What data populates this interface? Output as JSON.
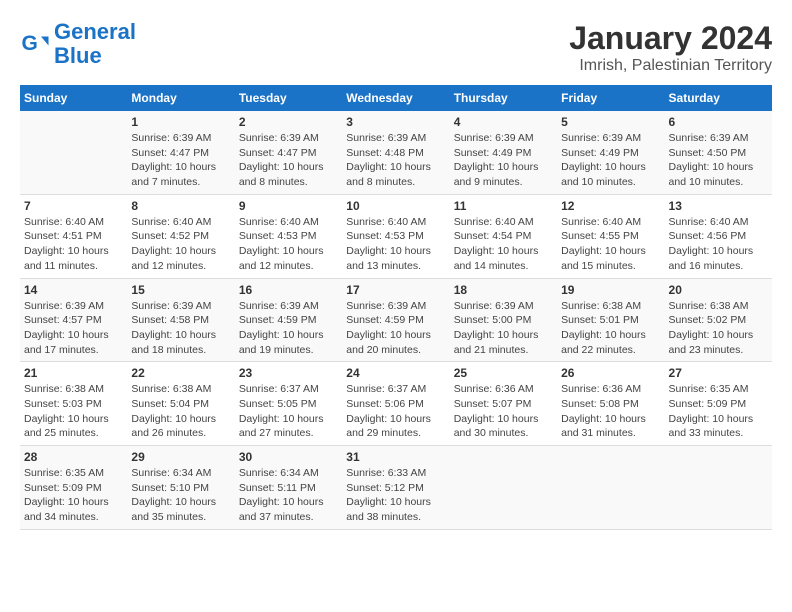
{
  "logo": {
    "line1": "General",
    "line2": "Blue"
  },
  "title": "January 2024",
  "subtitle": "Imrish, Palestinian Territory",
  "weekdays": [
    "Sunday",
    "Monday",
    "Tuesday",
    "Wednesday",
    "Thursday",
    "Friday",
    "Saturday"
  ],
  "weeks": [
    [
      {
        "day": "",
        "info": ""
      },
      {
        "day": "1",
        "info": "Sunrise: 6:39 AM\nSunset: 4:47 PM\nDaylight: 10 hours\nand 7 minutes."
      },
      {
        "day": "2",
        "info": "Sunrise: 6:39 AM\nSunset: 4:47 PM\nDaylight: 10 hours\nand 8 minutes."
      },
      {
        "day": "3",
        "info": "Sunrise: 6:39 AM\nSunset: 4:48 PM\nDaylight: 10 hours\nand 8 minutes."
      },
      {
        "day": "4",
        "info": "Sunrise: 6:39 AM\nSunset: 4:49 PM\nDaylight: 10 hours\nand 9 minutes."
      },
      {
        "day": "5",
        "info": "Sunrise: 6:39 AM\nSunset: 4:49 PM\nDaylight: 10 hours\nand 10 minutes."
      },
      {
        "day": "6",
        "info": "Sunrise: 6:39 AM\nSunset: 4:50 PM\nDaylight: 10 hours\nand 10 minutes."
      }
    ],
    [
      {
        "day": "7",
        "info": "Sunrise: 6:40 AM\nSunset: 4:51 PM\nDaylight: 10 hours\nand 11 minutes."
      },
      {
        "day": "8",
        "info": "Sunrise: 6:40 AM\nSunset: 4:52 PM\nDaylight: 10 hours\nand 12 minutes."
      },
      {
        "day": "9",
        "info": "Sunrise: 6:40 AM\nSunset: 4:53 PM\nDaylight: 10 hours\nand 12 minutes."
      },
      {
        "day": "10",
        "info": "Sunrise: 6:40 AM\nSunset: 4:53 PM\nDaylight: 10 hours\nand 13 minutes."
      },
      {
        "day": "11",
        "info": "Sunrise: 6:40 AM\nSunset: 4:54 PM\nDaylight: 10 hours\nand 14 minutes."
      },
      {
        "day": "12",
        "info": "Sunrise: 6:40 AM\nSunset: 4:55 PM\nDaylight: 10 hours\nand 15 minutes."
      },
      {
        "day": "13",
        "info": "Sunrise: 6:40 AM\nSunset: 4:56 PM\nDaylight: 10 hours\nand 16 minutes."
      }
    ],
    [
      {
        "day": "14",
        "info": "Sunrise: 6:39 AM\nSunset: 4:57 PM\nDaylight: 10 hours\nand 17 minutes."
      },
      {
        "day": "15",
        "info": "Sunrise: 6:39 AM\nSunset: 4:58 PM\nDaylight: 10 hours\nand 18 minutes."
      },
      {
        "day": "16",
        "info": "Sunrise: 6:39 AM\nSunset: 4:59 PM\nDaylight: 10 hours\nand 19 minutes."
      },
      {
        "day": "17",
        "info": "Sunrise: 6:39 AM\nSunset: 4:59 PM\nDaylight: 10 hours\nand 20 minutes."
      },
      {
        "day": "18",
        "info": "Sunrise: 6:39 AM\nSunset: 5:00 PM\nDaylight: 10 hours\nand 21 minutes."
      },
      {
        "day": "19",
        "info": "Sunrise: 6:38 AM\nSunset: 5:01 PM\nDaylight: 10 hours\nand 22 minutes."
      },
      {
        "day": "20",
        "info": "Sunrise: 6:38 AM\nSunset: 5:02 PM\nDaylight: 10 hours\nand 23 minutes."
      }
    ],
    [
      {
        "day": "21",
        "info": "Sunrise: 6:38 AM\nSunset: 5:03 PM\nDaylight: 10 hours\nand 25 minutes."
      },
      {
        "day": "22",
        "info": "Sunrise: 6:38 AM\nSunset: 5:04 PM\nDaylight: 10 hours\nand 26 minutes."
      },
      {
        "day": "23",
        "info": "Sunrise: 6:37 AM\nSunset: 5:05 PM\nDaylight: 10 hours\nand 27 minutes."
      },
      {
        "day": "24",
        "info": "Sunrise: 6:37 AM\nSunset: 5:06 PM\nDaylight: 10 hours\nand 29 minutes."
      },
      {
        "day": "25",
        "info": "Sunrise: 6:36 AM\nSunset: 5:07 PM\nDaylight: 10 hours\nand 30 minutes."
      },
      {
        "day": "26",
        "info": "Sunrise: 6:36 AM\nSunset: 5:08 PM\nDaylight: 10 hours\nand 31 minutes."
      },
      {
        "day": "27",
        "info": "Sunrise: 6:35 AM\nSunset: 5:09 PM\nDaylight: 10 hours\nand 33 minutes."
      }
    ],
    [
      {
        "day": "28",
        "info": "Sunrise: 6:35 AM\nSunset: 5:09 PM\nDaylight: 10 hours\nand 34 minutes."
      },
      {
        "day": "29",
        "info": "Sunrise: 6:34 AM\nSunset: 5:10 PM\nDaylight: 10 hours\nand 35 minutes."
      },
      {
        "day": "30",
        "info": "Sunrise: 6:34 AM\nSunset: 5:11 PM\nDaylight: 10 hours\nand 37 minutes."
      },
      {
        "day": "31",
        "info": "Sunrise: 6:33 AM\nSunset: 5:12 PM\nDaylight: 10 hours\nand 38 minutes."
      },
      {
        "day": "",
        "info": ""
      },
      {
        "day": "",
        "info": ""
      },
      {
        "day": "",
        "info": ""
      }
    ]
  ]
}
